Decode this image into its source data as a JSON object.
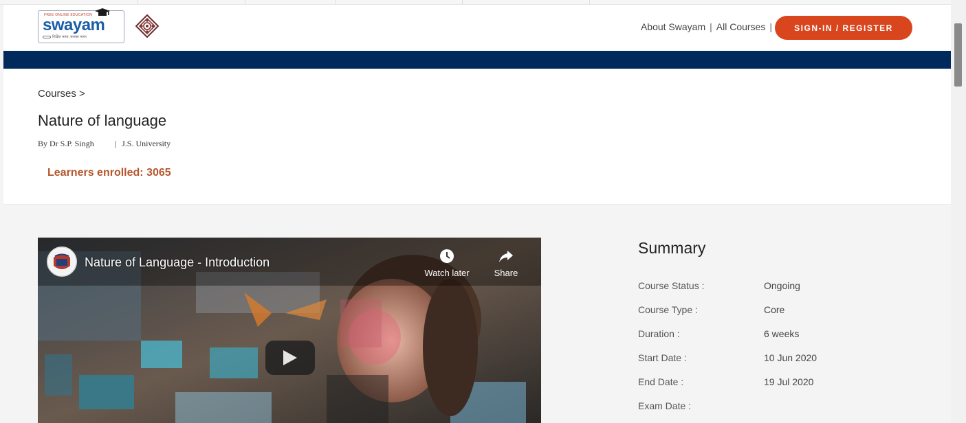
{
  "header": {
    "logo_text": "swayam",
    "logo_small_top": "FREE ONLINE EDUCATION",
    "logo_tagline": "शिक्षित भारत, सशक्त भारत",
    "nav": [
      {
        "label": "About Swayam"
      },
      {
        "label": "All Courses"
      }
    ],
    "nav_separator": "|",
    "signin_label": "SIGN-IN / REGISTER"
  },
  "course": {
    "breadcrumb": "Courses  >",
    "title": "Nature of language",
    "instructor": "By Dr S.P. Singh",
    "byline_separator": "|",
    "university": "J.S. University",
    "enrolled": "Learners enrolled: 3065"
  },
  "video": {
    "title": "Nature of Language - Introduction",
    "watch_later_label": "Watch later",
    "share_label": "Share"
  },
  "summary": {
    "heading": "Summary",
    "rows": [
      {
        "key": "Course Status :",
        "value": "Ongoing"
      },
      {
        "key": "Course Type :",
        "value": "Core"
      },
      {
        "key": "Duration :",
        "value": "6 weeks"
      },
      {
        "key": "Start Date :",
        "value": "10 Jun 2020"
      },
      {
        "key": "End Date :",
        "value": "19 Jul 2020"
      },
      {
        "key": "Exam Date :",
        "value": ""
      }
    ]
  },
  "colors": {
    "brand_blue": "#002a5c",
    "signin_orange": "#d9461e",
    "enrolled_text": "#b5562c"
  }
}
